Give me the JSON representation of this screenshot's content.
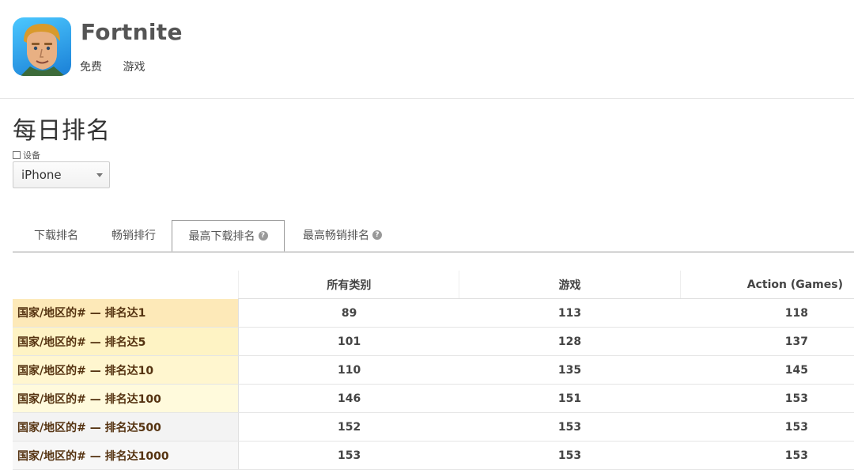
{
  "app": {
    "name": "Fortnite",
    "price": "免费",
    "category": "游戏"
  },
  "section": {
    "title": "每日排名",
    "device_label": "设备",
    "device_value": "iPhone"
  },
  "tabs": [
    {
      "label": "下载排名",
      "active": false,
      "help": false
    },
    {
      "label": "畅销排行",
      "active": false,
      "help": false
    },
    {
      "label": "最高下载排名",
      "active": true,
      "help": true
    },
    {
      "label": "最高畅销排名",
      "active": false,
      "help": true
    }
  ],
  "table": {
    "columns": [
      "所有类别",
      "游戏",
      "Action (Games)"
    ],
    "rows": [
      {
        "label": "国家/地区的# — 排名达1",
        "values": [
          "89",
          "113",
          "118"
        ],
        "bg": "#fde9b8"
      },
      {
        "label": "国家/地区的# — 排名达5",
        "values": [
          "101",
          "128",
          "137"
        ],
        "bg": "#fef3c4"
      },
      {
        "label": "国家/地区的# — 排名达10",
        "values": [
          "110",
          "135",
          "145"
        ],
        "bg": "#fff6cf"
      },
      {
        "label": "国家/地区的# — 排名达100",
        "values": [
          "146",
          "151",
          "153"
        ],
        "bg": "#fffadc"
      },
      {
        "label": "国家/地区的# — 排名达500",
        "values": [
          "152",
          "153",
          "153"
        ],
        "bg": "#f3f3f3"
      },
      {
        "label": "国家/地区的# — 排名达1000",
        "values": [
          "153",
          "153",
          "153"
        ],
        "bg": "#f7f7f7"
      }
    ]
  }
}
